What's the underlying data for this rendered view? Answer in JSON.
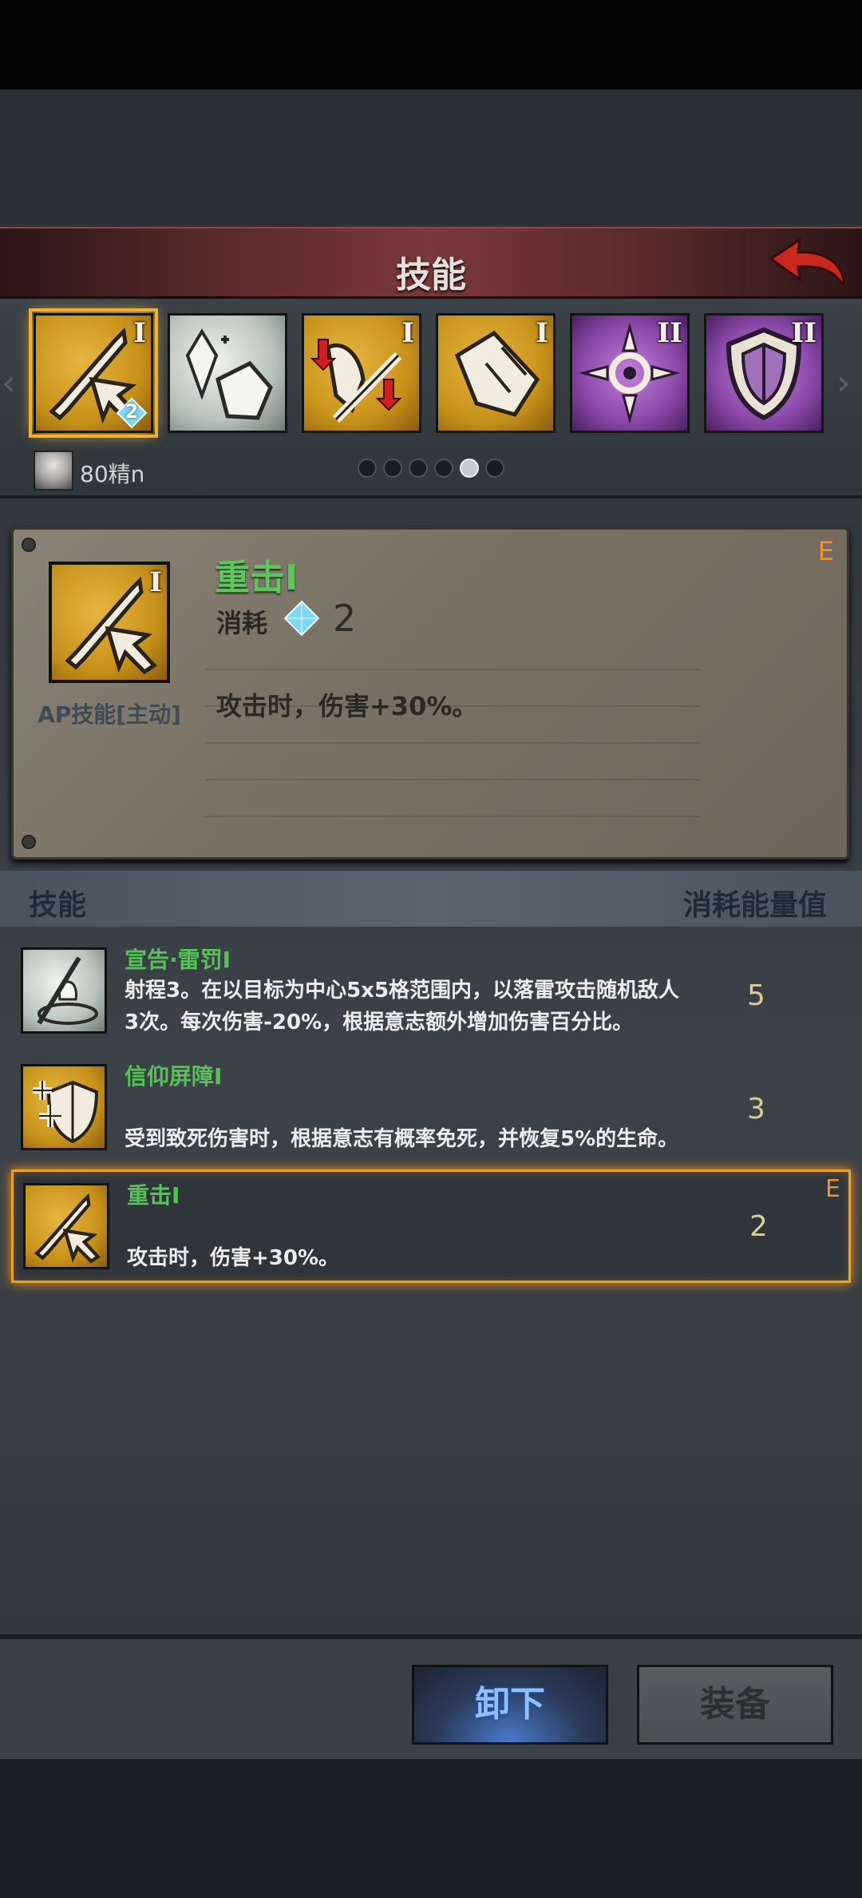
{
  "header": {
    "title": "技能",
    "back_icon": "back-arrow-icon"
  },
  "tabs": [
    {
      "icon": "sword-strike-icon",
      "tier": "I",
      "style": "gold",
      "cost": "2",
      "selected": true
    },
    {
      "icon": "crystal-gauntlet-icon",
      "tier": "",
      "style": "silver"
    },
    {
      "icon": "sword-debuff-icon",
      "tier": "I",
      "style": "gold"
    },
    {
      "icon": "armored-fist-icon",
      "tier": "I",
      "style": "gold"
    },
    {
      "icon": "crosshair-ornament-icon",
      "tier": "II",
      "style": "purple"
    },
    {
      "icon": "shield-icon",
      "tier": "II",
      "style": "purple"
    }
  ],
  "character": {
    "name": "80精n",
    "avatar": "character-avatar"
  },
  "pagination": {
    "total": 6,
    "active_index": 4
  },
  "detail": {
    "name": "重击I",
    "cost_label": "消耗",
    "cost_value": "2",
    "type": "AP技能[主动]",
    "description": "攻击时，伤害+30%。",
    "grade": "E",
    "tier": "I"
  },
  "list_header": {
    "skill_col": "技能",
    "cost_col": "消耗能量值"
  },
  "skills": [
    {
      "name": "宣告·雷罚I",
      "desc_line1": "射程3。在以目标为中心5x5格范围内，以落雷攻击随机敌人",
      "desc_line2": "3次。每次伤害-20%，根据意志额外增加伤害百分比。",
      "cost": "5",
      "grade": ""
    },
    {
      "name": "信仰屏障I",
      "desc_line1": "",
      "desc_line2": "受到致死伤害时，根据意志有概率免死，并恢复5%的生命。",
      "cost": "3",
      "grade": ""
    },
    {
      "name": "重击I",
      "desc_line1": "",
      "desc_line2": "攻击时，伤害+30%。",
      "cost": "2",
      "grade": "E"
    }
  ],
  "buttons": {
    "unequip": "卸下",
    "equip": "装备"
  },
  "colors": {
    "gold": "#c8921a",
    "purple": "#8a48a8",
    "green_name": "#5cc85c",
    "grade": "#f09030",
    "header": "#7a3838"
  }
}
